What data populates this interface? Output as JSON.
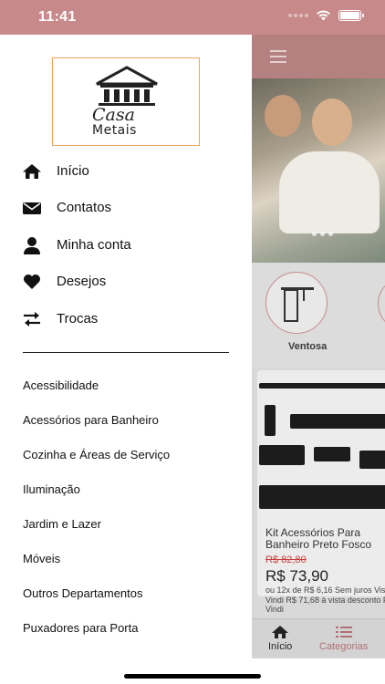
{
  "status_bar": {
    "time": "11:41",
    "icons": [
      "cellular-dots-icon",
      "wifi-icon",
      "battery-icon"
    ]
  },
  "drawer": {
    "logo": {
      "line1": "Casa",
      "line2": "Metais"
    },
    "menu": [
      {
        "label": "Início",
        "icon": "home-icon"
      },
      {
        "label": "Contatos",
        "icon": "mail-icon"
      },
      {
        "label": "Minha conta",
        "icon": "user-icon"
      },
      {
        "label": "Desejos",
        "icon": "heart-icon"
      },
      {
        "label": "Trocas",
        "icon": "swap-arrows-icon"
      }
    ],
    "departments": [
      "Acessibilidade",
      "Acessórios para Banheiro",
      "Cozinha e Áreas de Serviço",
      "Iluminação",
      "Jardim e Lazer",
      "Móveis",
      "Outros Departamentos",
      "Puxadores para Porta"
    ]
  },
  "background_app": {
    "category": "Ventosa",
    "product": {
      "title": "Kit Acessórios Para Banheiro Preto Fosco",
      "old_price": "R$ 82,80",
      "price": "R$ 73,90",
      "installments": "ou 12x de R$ 6,16 Sem juros Visa - Vindi R$ 71,68 à vista desconto Pix - Vindi"
    },
    "tabs": [
      {
        "label": "Início",
        "icon": "home-icon"
      },
      {
        "label": "Categorias",
        "icon": "list-icon"
      }
    ]
  },
  "colors": {
    "brand": "#c8898b",
    "logo_border": "#e7a55f",
    "price_old": "#c84040",
    "tab_active": "#b07075"
  }
}
